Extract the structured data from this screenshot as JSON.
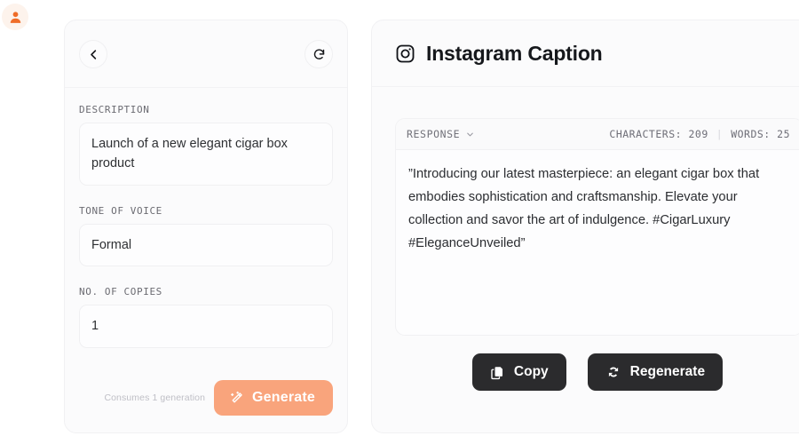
{
  "account": {
    "avatar_icon": "user-avatar-icon"
  },
  "left_panel": {
    "back_icon": "chevron-left-icon",
    "reset_icon": "refresh-cw-icon",
    "fields": [
      {
        "label": "DESCRIPTION",
        "value": "Launch of a new elegant cigar box product",
        "placeholder": "Describe your product"
      },
      {
        "label": "TONE OF VOICE",
        "value": "Formal",
        "placeholder": "Select a tone"
      },
      {
        "label": "NO. OF COPIES",
        "value": "1",
        "placeholder": "1"
      }
    ],
    "consume_note": "Consumes 1 generation",
    "generate_label": "Generate",
    "generate_icon": "magic-wand-icon"
  },
  "right_panel": {
    "title": "Instagram Caption",
    "title_icon": "instagram-icon",
    "response_label": "RESPONSE",
    "response_caret_icon": "chevron-down-icon",
    "characters_label": "CHARACTERS: 209",
    "separator": "|",
    "words_label": "WORDS: 25",
    "response_text": "”Introducing our latest masterpiece: an elegant cigar box that embodies sophistication and craftsmanship. Elevate your collection and savor the art of indulgence. #CigarLuxury #EleganceUnveiled”",
    "copy_label": "Copy",
    "copy_icon": "copy-icon",
    "regenerate_label": "Regenerate",
    "regenerate_icon": "refresh-cycle-icon"
  },
  "colors": {
    "accent": "#f9a47c",
    "avatar": "#ef6c27",
    "dark_button": "#2b2b2d",
    "page_bg": "#ffffff",
    "card_bg": "#fbfbfc"
  }
}
